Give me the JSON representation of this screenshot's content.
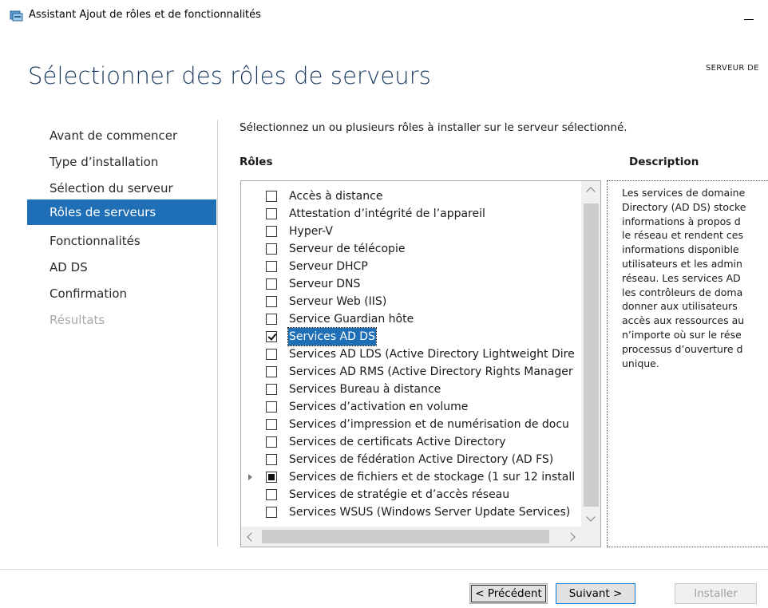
{
  "window": {
    "title": "Assistant Ajout de rôles et de fonctionnalités",
    "minimize_label": "—"
  },
  "page": {
    "heading": "Sélectionner des rôles de serveurs",
    "server_label": "SERVEUR DE"
  },
  "nav": {
    "items": [
      {
        "label": "Avant de commencer",
        "state": "normal"
      },
      {
        "label": "Type d’installation",
        "state": "normal"
      },
      {
        "label": "Sélection du serveur",
        "state": "normal"
      },
      {
        "label": "Rôles de serveurs",
        "state": "active"
      },
      {
        "label": "Fonctionnalités",
        "state": "normal"
      },
      {
        "label": "AD DS",
        "state": "normal"
      },
      {
        "label": "Confirmation",
        "state": "normal"
      },
      {
        "label": "Résultats",
        "state": "disabled"
      }
    ]
  },
  "main": {
    "instruction": "Sélectionnez un ou plusieurs rôles à installer sur le serveur sélectionné.",
    "roles_header": "Rôles",
    "description_header": "Description",
    "roles": [
      {
        "label": "Accès à distance",
        "checked": false
      },
      {
        "label": "Attestation d’intégrité de l’appareil",
        "checked": false
      },
      {
        "label": "Hyper-V",
        "checked": false
      },
      {
        "label": "Serveur de télécopie",
        "checked": false
      },
      {
        "label": "Serveur DHCP",
        "checked": false
      },
      {
        "label": "Serveur DNS",
        "checked": false
      },
      {
        "label": "Serveur Web (IIS)",
        "checked": false
      },
      {
        "label": "Service Guardian hôte",
        "checked": false
      },
      {
        "label": "Services AD DS",
        "checked": true,
        "selected": true
      },
      {
        "label": "Services AD LDS (Active Directory Lightweight Dire",
        "checked": false
      },
      {
        "label": "Services AD RMS (Active Directory Rights Manager",
        "checked": false
      },
      {
        "label": "Services Bureau à distance",
        "checked": false
      },
      {
        "label": "Services d’activation en volume",
        "checked": false
      },
      {
        "label": "Services d’impression et de numérisation de docu",
        "checked": false
      },
      {
        "label": "Services de certificats Active Directory",
        "checked": false
      },
      {
        "label": "Services de fédération Active Directory (AD FS)",
        "checked": false
      },
      {
        "label": "Services de fichiers et de stockage (1 sur 12 install",
        "checked": "partial",
        "expandable": true
      },
      {
        "label": "Services de stratégie et d’accès réseau",
        "checked": false
      },
      {
        "label": "Services WSUS (Windows Server Update Services)",
        "checked": false
      }
    ],
    "description_lines": [
      "Les services de domaine",
      "Directory (AD DS) stocke",
      "informations à propos d",
      "le réseau et rendent ces",
      "informations disponible",
      "utilisateurs et les admin",
      "réseau. Les services AD",
      "les contrôleurs de doma",
      "donner aux utilisateurs",
      "accès aux ressources au",
      "n’importe où sur le rése",
      "processus d’ouverture d",
      "unique."
    ]
  },
  "footer": {
    "prev_label": "< Précédent",
    "next_label": "Suivant >",
    "install_label": "Installer"
  },
  "colors": {
    "accent": "#1f6fb7",
    "heading": "#1a3b5f"
  }
}
